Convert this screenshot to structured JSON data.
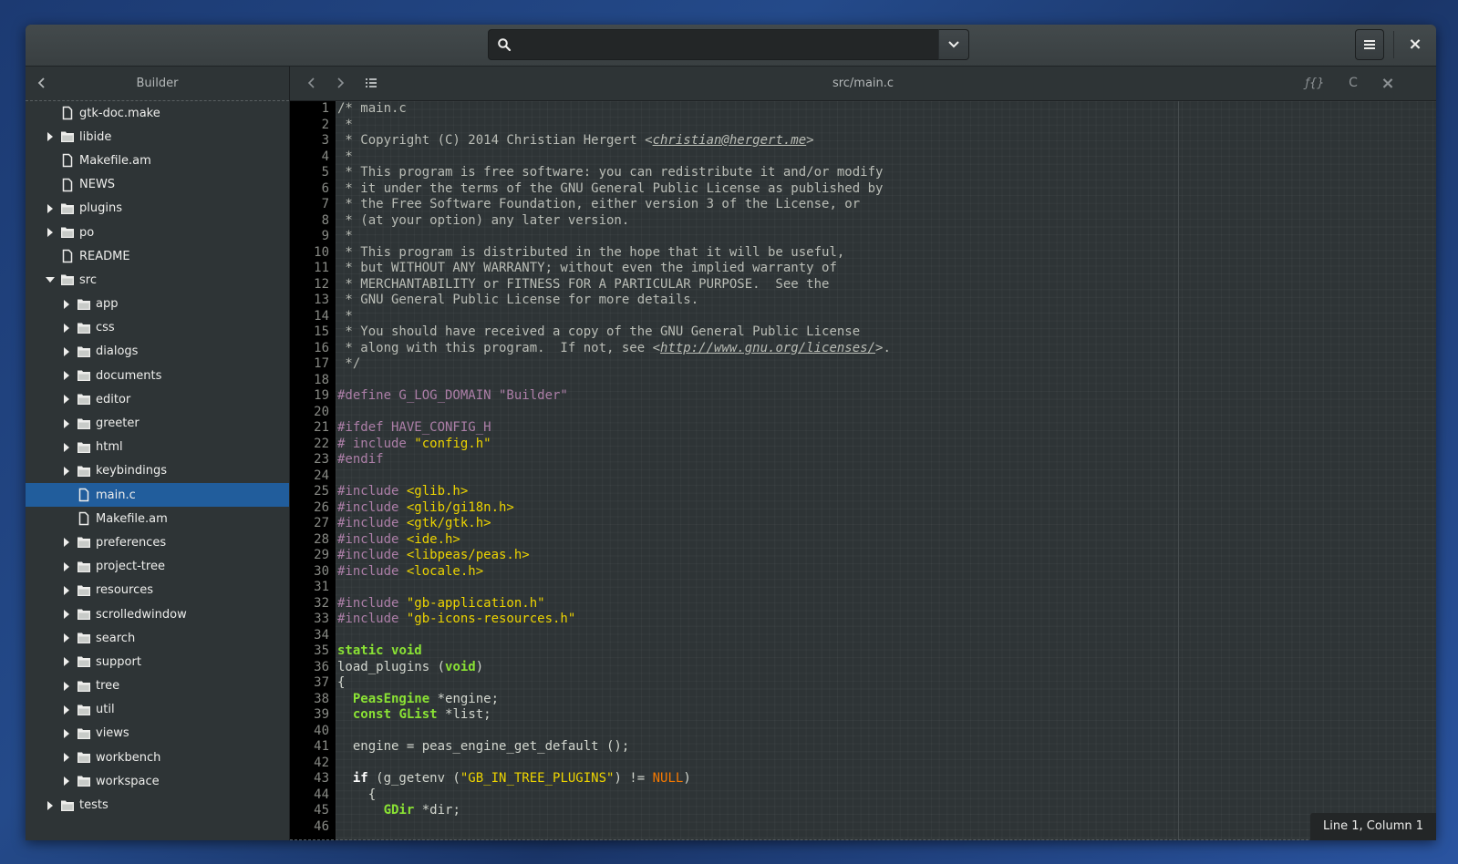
{
  "headerbar": {
    "search_placeholder": "",
    "search_value": "",
    "icons": {
      "search": "search-icon",
      "dropdown": "chevron-down-icon",
      "menu": "hamburger-menu-icon",
      "close": "close-icon"
    },
    "close_glyph": "×"
  },
  "sidebar": {
    "title": "Builder",
    "items": [
      {
        "label": "gtk-doc.make",
        "type": "file",
        "depth": 0,
        "expander": "none"
      },
      {
        "label": "libide",
        "type": "folder",
        "depth": 0,
        "expander": "collapsed"
      },
      {
        "label": "Makefile.am",
        "type": "file",
        "depth": 0,
        "expander": "none"
      },
      {
        "label": "NEWS",
        "type": "file",
        "depth": 0,
        "expander": "none"
      },
      {
        "label": "plugins",
        "type": "folder",
        "depth": 0,
        "expander": "collapsed"
      },
      {
        "label": "po",
        "type": "folder",
        "depth": 0,
        "expander": "collapsed"
      },
      {
        "label": "README",
        "type": "file",
        "depth": 0,
        "expander": "none"
      },
      {
        "label": "src",
        "type": "folder",
        "depth": 0,
        "expander": "expanded"
      },
      {
        "label": "app",
        "type": "folder",
        "depth": 1,
        "expander": "collapsed"
      },
      {
        "label": "css",
        "type": "folder",
        "depth": 1,
        "expander": "collapsed"
      },
      {
        "label": "dialogs",
        "type": "folder",
        "depth": 1,
        "expander": "collapsed"
      },
      {
        "label": "documents",
        "type": "folder",
        "depth": 1,
        "expander": "collapsed"
      },
      {
        "label": "editor",
        "type": "folder",
        "depth": 1,
        "expander": "collapsed"
      },
      {
        "label": "greeter",
        "type": "folder",
        "depth": 1,
        "expander": "collapsed"
      },
      {
        "label": "html",
        "type": "folder",
        "depth": 1,
        "expander": "collapsed"
      },
      {
        "label": "keybindings",
        "type": "folder",
        "depth": 1,
        "expander": "collapsed"
      },
      {
        "label": "main.c",
        "type": "file",
        "depth": 1,
        "expander": "none",
        "selected": true
      },
      {
        "label": "Makefile.am",
        "type": "file",
        "depth": 1,
        "expander": "none"
      },
      {
        "label": "preferences",
        "type": "folder",
        "depth": 1,
        "expander": "collapsed"
      },
      {
        "label": "project-tree",
        "type": "folder",
        "depth": 1,
        "expander": "collapsed"
      },
      {
        "label": "resources",
        "type": "folder",
        "depth": 1,
        "expander": "collapsed"
      },
      {
        "label": "scrolledwindow",
        "type": "folder",
        "depth": 1,
        "expander": "collapsed"
      },
      {
        "label": "search",
        "type": "folder",
        "depth": 1,
        "expander": "collapsed"
      },
      {
        "label": "support",
        "type": "folder",
        "depth": 1,
        "expander": "collapsed"
      },
      {
        "label": "tree",
        "type": "folder",
        "depth": 1,
        "expander": "collapsed"
      },
      {
        "label": "util",
        "type": "folder",
        "depth": 1,
        "expander": "collapsed"
      },
      {
        "label": "views",
        "type": "folder",
        "depth": 1,
        "expander": "collapsed"
      },
      {
        "label": "workbench",
        "type": "folder",
        "depth": 1,
        "expander": "collapsed"
      },
      {
        "label": "workspace",
        "type": "folder",
        "depth": 1,
        "expander": "collapsed"
      },
      {
        "label": "tests",
        "type": "folder",
        "depth": 0,
        "expander": "collapsed"
      }
    ]
  },
  "editor": {
    "title": "src/main.c",
    "toolbar": {
      "symbols_glyph": "ƒ{}",
      "language_glyph": "C",
      "close_glyph": "×"
    },
    "status": "Line 1, Column 1",
    "lines": [
      [
        [
          "c-comment",
          "/* main.c"
        ]
      ],
      [
        [
          "c-comment",
          " *"
        ]
      ],
      [
        [
          "c-comment",
          " * Copyright (C) 2014 Christian Hergert <"
        ],
        [
          "c-comment c-link",
          "christian@hergert.me"
        ],
        [
          "c-comment",
          ">"
        ]
      ],
      [
        [
          "c-comment",
          " *"
        ]
      ],
      [
        [
          "c-comment",
          " * This program is free software: you can redistribute it and/or modify"
        ]
      ],
      [
        [
          "c-comment",
          " * it under the terms of the GNU General Public License as published by"
        ]
      ],
      [
        [
          "c-comment",
          " * the Free Software Foundation, either version 3 of the License, or"
        ]
      ],
      [
        [
          "c-comment",
          " * (at your option) any later version."
        ]
      ],
      [
        [
          "c-comment",
          " *"
        ]
      ],
      [
        [
          "c-comment",
          " * This program is distributed in the hope that it will be useful,"
        ]
      ],
      [
        [
          "c-comment",
          " * but WITHOUT ANY WARRANTY; without even the implied warranty of"
        ]
      ],
      [
        [
          "c-comment",
          " * MERCHANTABILITY or FITNESS FOR A PARTICULAR PURPOSE.  See the"
        ]
      ],
      [
        [
          "c-comment",
          " * GNU General Public License for more details."
        ]
      ],
      [
        [
          "c-comment",
          " *"
        ]
      ],
      [
        [
          "c-comment",
          " * You should have received a copy of the GNU General Public License"
        ]
      ],
      [
        [
          "c-comment",
          " * along with this program.  If not, see <"
        ],
        [
          "c-comment c-link",
          "http://www.gnu.org/licenses/"
        ],
        [
          "c-comment",
          ">."
        ]
      ],
      [
        [
          "c-comment",
          " */"
        ]
      ],
      [],
      [
        [
          "c-pre",
          "#define G_LOG_DOMAIN \"Builder\""
        ]
      ],
      [],
      [
        [
          "c-pre",
          "#ifdef HAVE_CONFIG_H"
        ]
      ],
      [
        [
          "c-pre",
          "# include "
        ],
        [
          "c-str",
          "\"config.h\""
        ]
      ],
      [
        [
          "c-pre",
          "#endif"
        ]
      ],
      [],
      [
        [
          "c-pre",
          "#include "
        ],
        [
          "c-str",
          "<glib.h>"
        ]
      ],
      [
        [
          "c-pre",
          "#include "
        ],
        [
          "c-str",
          "<glib/gi18n.h>"
        ]
      ],
      [
        [
          "c-pre",
          "#include "
        ],
        [
          "c-str",
          "<gtk/gtk.h>"
        ]
      ],
      [
        [
          "c-pre",
          "#include "
        ],
        [
          "c-str",
          "<ide.h>"
        ]
      ],
      [
        [
          "c-pre",
          "#include "
        ],
        [
          "c-str",
          "<libpeas/peas.h>"
        ]
      ],
      [
        [
          "c-pre",
          "#include "
        ],
        [
          "c-str",
          "<locale.h>"
        ]
      ],
      [],
      [
        [
          "c-pre",
          "#include "
        ],
        [
          "c-str",
          "\"gb-application.h\""
        ]
      ],
      [
        [
          "c-pre",
          "#include "
        ],
        [
          "c-str",
          "\"gb-icons-resources.h\""
        ]
      ],
      [],
      [
        [
          "c-kw",
          "static"
        ],
        [
          "c-plain",
          " "
        ],
        [
          "c-kw",
          "void"
        ]
      ],
      [
        [
          "c-plain",
          "load_plugins ("
        ],
        [
          "c-kw",
          "void"
        ],
        [
          "c-plain",
          ")"
        ]
      ],
      [
        [
          "c-plain",
          "{"
        ]
      ],
      [
        [
          "c-plain",
          "  "
        ],
        [
          "c-type",
          "PeasEngine"
        ],
        [
          "c-plain",
          " *engine;"
        ]
      ],
      [
        [
          "c-plain",
          "  "
        ],
        [
          "c-kw",
          "const"
        ],
        [
          "c-plain",
          " "
        ],
        [
          "c-type",
          "GList"
        ],
        [
          "c-plain",
          " *list;"
        ]
      ],
      [],
      [
        [
          "c-plain",
          "  engine = peas_engine_get_default ();"
        ]
      ],
      [],
      [
        [
          "c-plain",
          "  "
        ],
        [
          "c-ctl",
          "if"
        ],
        [
          "c-plain",
          " (g_getenv ("
        ],
        [
          "c-str",
          "\"GB_IN_TREE_PLUGINS\""
        ],
        [
          "c-plain",
          ") != "
        ],
        [
          "c-null",
          "NULL"
        ],
        [
          "c-plain",
          ")"
        ]
      ],
      [
        [
          "c-plain",
          "    {"
        ]
      ],
      [
        [
          "c-plain",
          "      "
        ],
        [
          "c-type",
          "GDir"
        ],
        [
          "c-plain",
          " *dir;"
        ]
      ],
      [
        [
          "c-plain",
          ""
        ]
      ]
    ]
  }
}
